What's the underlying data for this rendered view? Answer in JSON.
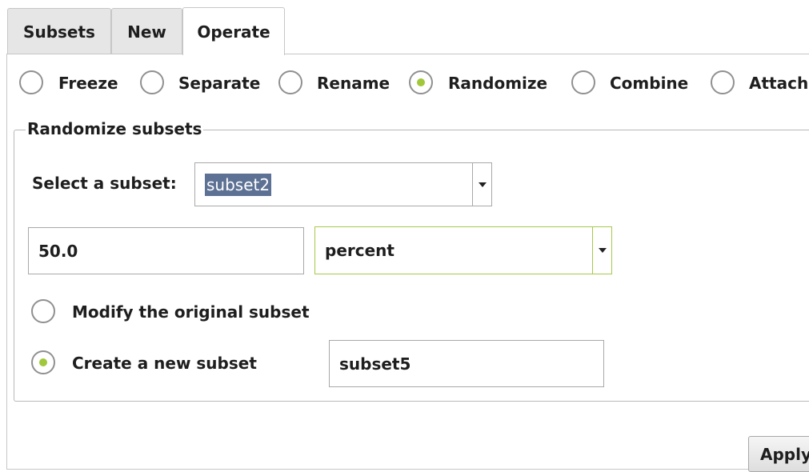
{
  "tabs": [
    {
      "label": "Subsets",
      "active": false
    },
    {
      "label": "New",
      "active": false
    },
    {
      "label": "Operate",
      "active": true
    }
  ],
  "operations": [
    {
      "label": "Freeze",
      "selected": false
    },
    {
      "label": "Separate",
      "selected": false
    },
    {
      "label": "Rename",
      "selected": false
    },
    {
      "label": "Randomize",
      "selected": true
    },
    {
      "label": "Combine",
      "selected": false
    },
    {
      "label": "Attach",
      "selected": false
    }
  ],
  "randomize": {
    "group_title": "Randomize subsets",
    "select_label": "Select a subset:",
    "subset_value": "subset2",
    "amount_value": "50.0",
    "unit_value": "percent",
    "modify_label": "Modify the original subset",
    "modify_selected": false,
    "create_label": "Create a new subset",
    "create_selected": true,
    "new_subset_name": "subset5"
  },
  "apply_label": "Apply",
  "colors": {
    "accent": "#a0c83a",
    "selection": "#5d7194"
  }
}
